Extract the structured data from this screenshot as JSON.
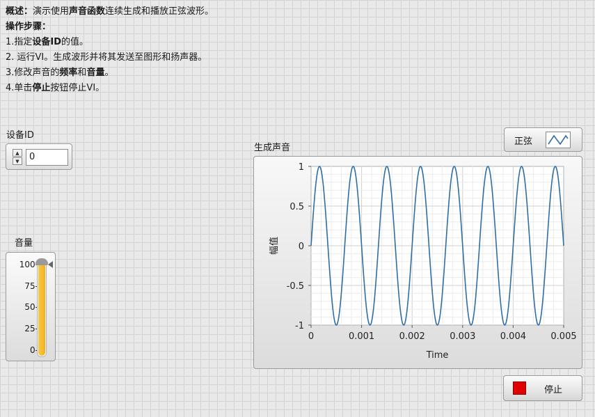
{
  "description": {
    "line1_label": "概述：",
    "line1_text_a": "演示使用",
    "line1_bold": "声音函数",
    "line1_text_b": "连续生成和播放正弦波形。",
    "line2": "操作步骤：",
    "line3_a": "1.指定",
    "line3_bold": "设备ID",
    "line3_b": "的值。",
    "line4": "2. 运行VI。生成波形并将其发送至图形和扬声器。",
    "line5_a": "3.修改声音的",
    "line5_bold1": "频率",
    "line5_mid": "和",
    "line5_bold2": "音量",
    "line5_b": "。",
    "line6_a": "4.单击",
    "line6_bold": "停止",
    "line6_b": "按钮停止VI。"
  },
  "device": {
    "label": "设备ID",
    "value": "0",
    "up_glyph": "▲",
    "down_glyph": "▼"
  },
  "volume": {
    "label": "音量",
    "ticks": [
      "100-",
      "75-",
      "50-",
      "25-",
      "0-"
    ],
    "value": 100,
    "max": 100
  },
  "graph": {
    "title": "生成声音",
    "legend_label": "正弦",
    "stop_label": "停止",
    "line_color": "#2f6ea4",
    "stop_color": "#e10000"
  },
  "chart_data": {
    "type": "line",
    "title": "",
    "xlabel": "Time",
    "ylabel": "幅值",
    "xlim": [
      0,
      0.005
    ],
    "ylim": [
      -1,
      1
    ],
    "x_ticks": [
      "0",
      "0.001",
      "0.002",
      "0.003",
      "0.004",
      "0.005"
    ],
    "y_ticks": [
      "1",
      "0.5",
      "0",
      "-0.5",
      "-1"
    ],
    "grid": true,
    "series": [
      {
        "name": "正弦",
        "frequency_hz": 1500,
        "amplitude": 1,
        "phase": 0
      }
    ]
  }
}
